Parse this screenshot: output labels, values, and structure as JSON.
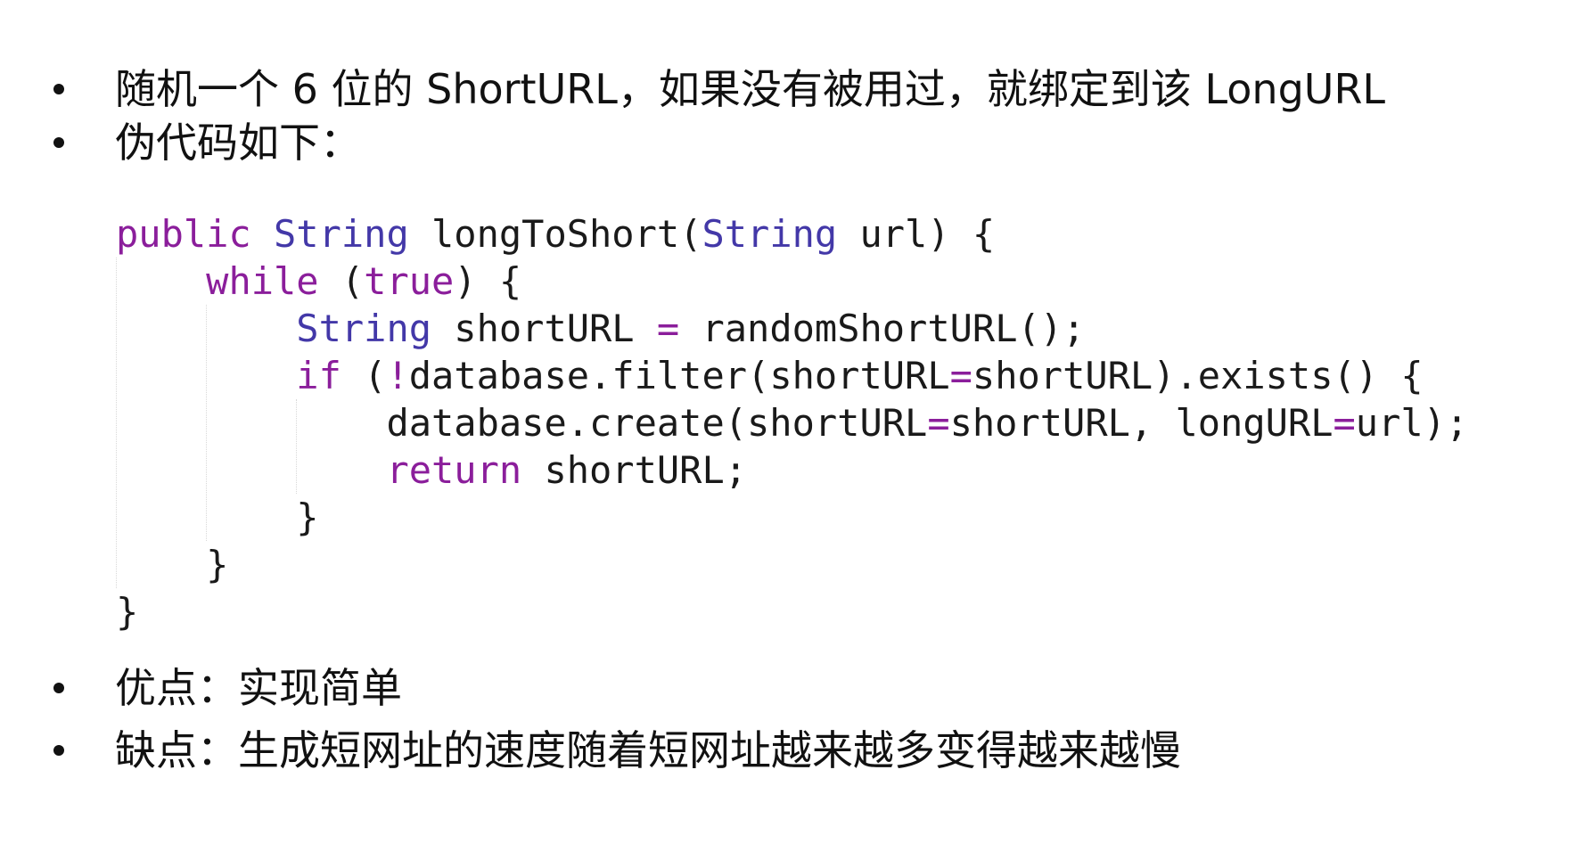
{
  "bullets": [
    "随机一个 6 位的 ShortURL，如果没有被用过，就绑定到该 LongURL",
    "伪代码如下：",
    "优点：实现简单",
    "缺点：生成短网址的速度随着短网址越来越多变得越来越慢"
  ],
  "code": {
    "l1": {
      "kw": "public",
      "ty1": "String",
      "mid": " longToShort(",
      "ty2": "String",
      "end": " url) {"
    },
    "l2": {
      "indent": "    ",
      "kw": "while",
      "mid": " (",
      "kw2": "true",
      "end": ") {"
    },
    "l3": {
      "indent": "        ",
      "ty": "String",
      "mid": " shortURL ",
      "op": "=",
      "end": " randomShortURL();"
    },
    "l4": {
      "indent": "        ",
      "kw": "if",
      "mid1": " (",
      "op1": "!",
      "mid2": "database.filter(shortURL",
      "op2": "=",
      "end": "shortURL).exists() {"
    },
    "l5": {
      "indent": "            ",
      "a": "database.create(shortURL",
      "op1": "=",
      "b": "shortURL, longURL",
      "op2": "=",
      "c": "url);"
    },
    "l6": {
      "indent": "            ",
      "kw": "return",
      "end": " shortURL;"
    },
    "l7": {
      "indent": "        ",
      "end": "}"
    },
    "l8": {
      "indent": "    ",
      "end": "}"
    },
    "l9": {
      "indent": "",
      "end": "}"
    }
  }
}
